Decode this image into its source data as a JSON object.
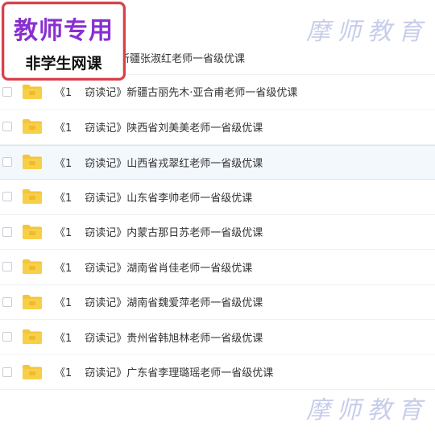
{
  "badge": {
    "title": "教师专用",
    "subtitle": "非学生网课"
  },
  "watermark": {
    "top": "摩师教育",
    "bottom": "摩师教育"
  },
  "first_row_partial": "新疆张淑红老师一省级优课",
  "files": [
    {
      "open": "《1",
      "name": "窃读记》新疆古丽先木·亚合甫老师一省级优课"
    },
    {
      "open": "《1",
      "name": "窃读记》陕西省刘美美老师一省级优课"
    },
    {
      "open": "《1",
      "name": "窃读记》山西省戎翠红老师一省级优课"
    },
    {
      "open": "《1",
      "name": "窃读记》山东省李帅老师一省级优课"
    },
    {
      "open": "《1",
      "name": "窃读记》内蒙古那日苏老师一省级优课"
    },
    {
      "open": "《1",
      "name": "窃读记》湖南省肖佳老师一省级优课"
    },
    {
      "open": "《1",
      "name": "窃读记》湖南省魏爱萍老师一省级优课"
    },
    {
      "open": "《1",
      "name": "窃读记》贵州省韩旭林老师一省级优课"
    },
    {
      "open": "《1",
      "name": "窃读记》广东省李理璐瑶老师一省级优课"
    }
  ],
  "colors": {
    "folder": "#f5c53a",
    "folder_dark": "#e9ad1c",
    "badge_border": "#d8404a",
    "badge_title": "#8a2fd0",
    "row_highlight": "#f3f8fd"
  },
  "icons": {
    "folder": "folder-icon",
    "checkbox": "checkbox"
  }
}
